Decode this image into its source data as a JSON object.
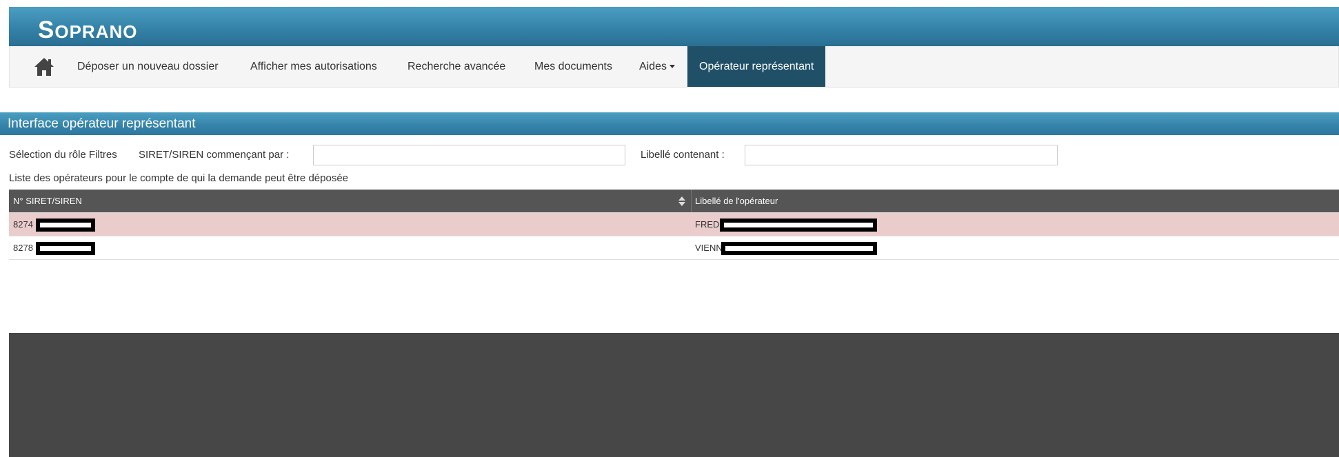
{
  "app": {
    "brand_initial": "S",
    "brand_rest": "OPRANO"
  },
  "nav": {
    "home_icon": "home-icon",
    "items": [
      {
        "label": "Déposer un nouveau dossier"
      },
      {
        "label": "Afficher mes autorisations"
      },
      {
        "label": "Recherche avancée"
      },
      {
        "label": "Mes documents"
      },
      {
        "label": "Aides"
      },
      {
        "label": "Opérateur représentant",
        "active": true
      }
    ]
  },
  "panel": {
    "title": "Interface opérateur représentant"
  },
  "filters": {
    "role_label": "Sélection du rôle Filtres",
    "siret_label": "SIRET/SIREN commençant par :",
    "siret_value": "",
    "libelle_label": "Libellé contenant :",
    "libelle_value": ""
  },
  "list": {
    "title": "Liste des opérateurs pour le compte de qui la demande peut être déposée",
    "columns": [
      "N° SIRET/SIREN",
      "Libellé de l'opérateur"
    ],
    "rows": [
      {
        "siret": "8274",
        "libelle": "FRED",
        "selected": true
      },
      {
        "siret": "8278",
        "libelle": "VIENN",
        "selected": false
      }
    ]
  },
  "colors": {
    "brand_blue": "#3582a8",
    "nav_active": "#1f5068",
    "table_header": "#555555",
    "selected_row": "#ebcccc",
    "footer": "#474747"
  }
}
